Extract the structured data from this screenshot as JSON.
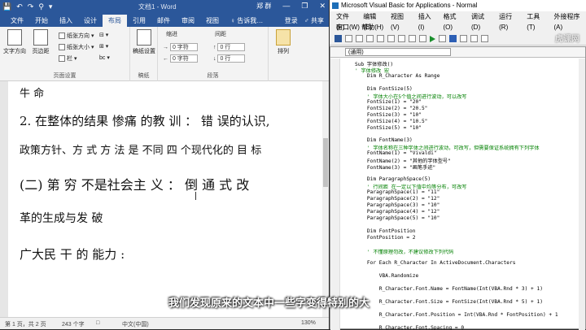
{
  "word": {
    "qat": [
      "💾",
      "↶",
      "↷",
      "⚲",
      "▾"
    ],
    "title": "文档1 - Word",
    "user": "郑 群",
    "controls": [
      "—",
      "❐",
      "✕"
    ],
    "tabs": [
      "文件",
      "开始",
      "插入",
      "设计",
      "布局",
      "引用",
      "邮件",
      "审阅",
      "视图",
      "♀ 告诉我…"
    ],
    "active_tab": "布局",
    "tabs_right": [
      "登录",
      "♂ 共享"
    ],
    "ribbon": {
      "text_direction": "文字方向",
      "margins": "页边距",
      "orientation": "纸张方向 ▾",
      "size": "纸张大小 ▾",
      "columns": "栏 ▾",
      "breaks": "⊟ ▾",
      "line_numbers": "⊞ ▾",
      "hyphenation": "bc ▾",
      "page_setup_label": "页面设置",
      "draft": "稿纸设置",
      "draft_label": "稿纸",
      "indent_label": "缩进",
      "spacing_label": "间距",
      "indent_left": "0 字符",
      "indent_right": "0 字符",
      "space_before": "0 行",
      "space_after": "0 行",
      "paragraph_label": "段落",
      "arrange": "排列"
    },
    "handwriting": {
      "line1": "牛 命",
      "line2": "2. 在整体的结果  惨痛 的教 训  ：  错 误的认识,",
      "line3": "政策方针、方 式 方 法 是 不同  四 个现代化的 目 标",
      "line4": "(二)   第  穷 不是社会主 义 ：  倒 通 式 改",
      "line5": "革的生成与发  破",
      "line6": "广大民   干  的 能力 :"
    },
    "status": {
      "page": "第 1 页，共 2 页",
      "words": "243 个字",
      "lang_icon": "□",
      "language": "中文(中国)",
      "zoom": "130%"
    }
  },
  "vbe": {
    "title": "Microsoft Visual Basic for Applications - Normal",
    "menu": [
      "文件(F)",
      "编辑(E)",
      "视图(V)",
      "插入(I)",
      "格式(O)",
      "调试(D)",
      "运行(R)",
      "工具(T)",
      "外接程序(A)"
    ],
    "menu2": "窗口(W)   帮助(H)",
    "watermark": "虎课网",
    "object_combo": "(通用)",
    "code": [
      {
        "t": "Sub 字体修改()",
        "c": false
      },
      {
        "t": "' 字体修改 宏",
        "c": true
      },
      {
        "t": "    Dim R_Character As Range",
        "c": false
      },
      {
        "t": "",
        "c": false
      },
      {
        "t": "    Dim FontSize(5)",
        "c": false
      },
      {
        "t": "    ' 字体大小在5个值之间进行波动，可以改写",
        "c": true
      },
      {
        "t": "    FontSize(1) = \"20\"",
        "c": false
      },
      {
        "t": "    FontSize(2) = \"20.5\"",
        "c": false
      },
      {
        "t": "    FontSize(3) = \"10\"",
        "c": false
      },
      {
        "t": "    FontSize(4) = \"10.5\"",
        "c": false
      },
      {
        "t": "    FontSize(5) = \"10\"",
        "c": false
      },
      {
        "t": "",
        "c": false
      },
      {
        "t": "    Dim FontName(3)",
        "c": false
      },
      {
        "t": "    ' 字体名称在三种字体之间进行波动，可改写，但需要保证系统拥有下列字体",
        "c": true
      },
      {
        "t": "    FontName(1) = \"Vivaldi\"",
        "c": false
      },
      {
        "t": "    FontName(2) = \"其他的字体型号\"",
        "c": false
      },
      {
        "t": "    FontName(3) = \"画笔手迹\"",
        "c": false
      },
      {
        "t": "",
        "c": false
      },
      {
        "t": "    Dim ParagraphSpace(5)",
        "c": false
      },
      {
        "t": "    ' 行间距 在一定以下值中均等分布，可改写",
        "c": true
      },
      {
        "t": "    ParagraphSpace(1) = \"11\"",
        "c": false
      },
      {
        "t": "    ParagraphSpace(2) = \"12\"",
        "c": false
      },
      {
        "t": "    ParagraphSpace(3) = \"10\"",
        "c": false
      },
      {
        "t": "    ParagraphSpace(4) = \"12\"",
        "c": false
      },
      {
        "t": "    ParagraphSpace(5) = \"10\"",
        "c": false
      },
      {
        "t": "",
        "c": false
      },
      {
        "t": "    Dim FontPosition",
        "c": false
      },
      {
        "t": "    FontPosition = 2",
        "c": false
      },
      {
        "t": "",
        "c": false
      },
      {
        "t": "    ' 不懂原理勿改，不建议修改下列代码",
        "c": true
      },
      {
        "t": "",
        "c": false
      },
      {
        "t": "    For Each R_Character In ActiveDocument.Characters",
        "c": false
      },
      {
        "t": "",
        "c": false
      },
      {
        "t": "        VBA.Randomize",
        "c": false
      },
      {
        "t": "",
        "c": false
      },
      {
        "t": "        R_Character.Font.Name = FontName(Int(VBA.Rnd * 3) + 1)",
        "c": false
      },
      {
        "t": "",
        "c": false
      },
      {
        "t": "        R_Character.Font.Size = FontSize(Int(VBA.Rnd * 5) + 1)",
        "c": false
      },
      {
        "t": "",
        "c": false
      },
      {
        "t": "        R_Character.Font.Position = Int(VBA.Rnd * FontPosition) + 1",
        "c": false
      },
      {
        "t": "",
        "c": false
      },
      {
        "t": "        R_Character.Font.Spacing = 0",
        "c": false
      }
    ]
  },
  "subtitle": "我们发现原来的文本中一些字变得特别的大"
}
